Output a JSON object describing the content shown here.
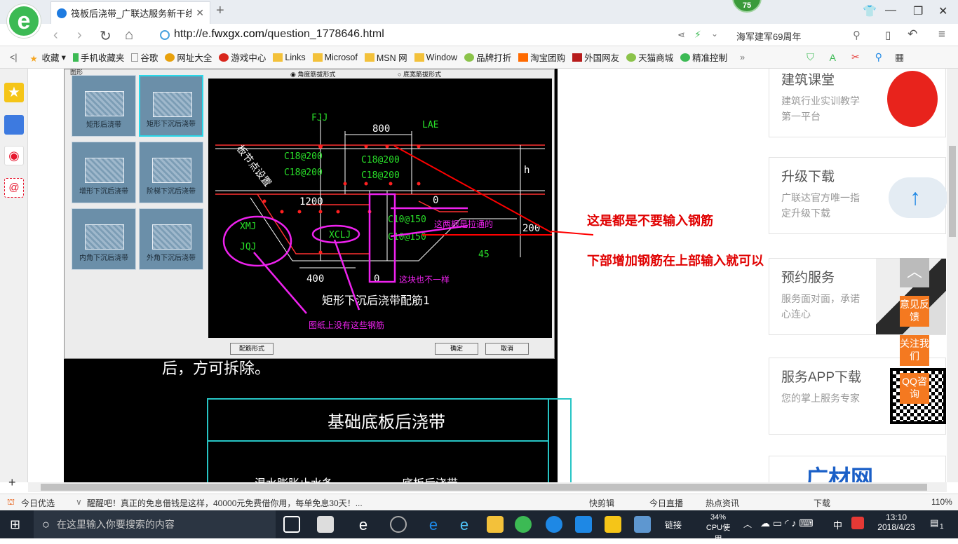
{
  "browser": {
    "tab_title": "筏板后浇带_广联达服务新干线",
    "badge": "75",
    "url_prefix": "http://e.",
    "url_domain": "fwxgx.com",
    "url_path": "/question_1778646.html",
    "search_text": "海军建军69周年"
  },
  "favorites": [
    "收藏",
    "手机收藏夹",
    "谷歌",
    "网址大全",
    "游戏中心",
    "Links",
    "Microsof",
    "MSN 网",
    "Window",
    "品牌打折",
    "淘宝团购",
    "外国网友",
    "天猫商城",
    "精准控制"
  ],
  "dialog": {
    "group_label": "图形",
    "radio_a": "角度筋拔形式",
    "radio_b": "底宽筋拔形式",
    "thumbs": [
      "矩形后浇带",
      "矩形下沉后浇带",
      "增形下沉后浇带",
      "阶梯下沉后浇带",
      "内角下沉后浇带",
      "外角下沉后浇带"
    ],
    "btn_config": "配筋形式",
    "btn_ok": "确定",
    "btn_cancel": "取消"
  },
  "drawing": {
    "fjj": "FJJ",
    "lae": "LAE",
    "dim_800": "800",
    "dim_1200": "1200",
    "dim_400": "400",
    "dim_0a": "0",
    "dim_0b": "0",
    "dim_200": "200",
    "dim_h": "h",
    "dim_45": "45",
    "bar1": "C18@200",
    "bar2": "C18@200",
    "bar3": "C18@200",
    "bar4": "C18@200",
    "bar5": "C10@150",
    "bar6": "C10@150",
    "xmj": "XMJ",
    "jqj": "JQJ",
    "xclj": "XCLJ",
    "slope": "板节点设置",
    "title": "矩形下沉后浇带配筋1",
    "note_tie": "这两根是拉通的",
    "note_diff": "这块也不一样",
    "note_missing": "图纸上没有这些钢筋"
  },
  "behind": {
    "partial_text": "后，方可拆除。",
    "table_title": "基础底板后浇带",
    "row_a": "混水膨胀止水条",
    "row_b": "底板后浇带"
  },
  "annotations": {
    "line1": "这是都是不要输入钢筋",
    "line2": "下部增加钢筋在上部输入就可以"
  },
  "cards": [
    {
      "title": "建筑课堂",
      "desc": "建筑行业实训教学第一平台"
    },
    {
      "title": "升级下载",
      "desc": "广联达官方唯一指定升级下载"
    },
    {
      "title": "预约服务",
      "desc": "服务面对面，承诺心连心"
    },
    {
      "title": "服务APP下载",
      "desc": "您的掌上服务专家"
    },
    {
      "title": "广材网",
      "desc": ""
    }
  ],
  "float_buttons": [
    "意见反馈",
    "关注我们",
    "QQ咨询"
  ],
  "status": {
    "daily": "今日优选",
    "news": "醒醒吧！真正的免息借钱是这样，40000元免费借你用，每单免息30天！...",
    "quick_cut": "快剪辑",
    "live": "今日直播",
    "hot": "热点资讯",
    "download": "下载",
    "zoom": "110%"
  },
  "taskbar": {
    "search_placeholder": "在这里输入你要搜索的内容",
    "links": "链接",
    "cpu_pct": "34%",
    "cpu_label": "CPU使用",
    "ime": "中",
    "time": "13:10",
    "date": "2018/4/23",
    "notif": "1"
  }
}
